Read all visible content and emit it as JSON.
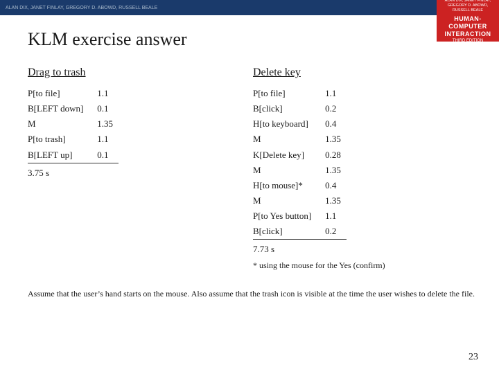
{
  "top_banner": {
    "text": "ALAN DIX, JANET FINLAY, GREGORY D. ABOWD, RUSSELL BEALE"
  },
  "logo": {
    "authors": "ALAN DIX, JANET FINLAY,\nGREGORY D. ABOWD, RUSSELL BEALE",
    "title": "HUMAN-COMPUTER\nINTERACTION",
    "edition": "THIRD EDITION"
  },
  "page_title": "KLM exercise answer",
  "drag_section": {
    "heading": "Drag to trash",
    "steps": [
      {
        "action": "P[to file]",
        "value": "1.1"
      },
      {
        "action": "B[LEFT down]",
        "value": "0.1"
      },
      {
        "action": "M",
        "value": "1.35"
      },
      {
        "action": "P[to trash]",
        "value": "1.1"
      },
      {
        "action": "B[LEFT up]",
        "value": "0.1"
      }
    ],
    "equals": "===",
    "total": "3.75 s"
  },
  "delete_section": {
    "heading": "Delete key",
    "steps": [
      {
        "action": "P[to file]",
        "value": "1.1"
      },
      {
        "action": "B[click]",
        "value": "0.2"
      },
      {
        "action": "H[to keyboard]",
        "value": "0.4"
      },
      {
        "action": "M",
        "value": "1.35"
      },
      {
        "action": "K[Delete key]",
        "value": "0.28"
      },
      {
        "action": "M",
        "value": "1.35"
      },
      {
        "action": "H[to mouse]*",
        "value": "0.4"
      },
      {
        "action": "M",
        "value": "1.35"
      },
      {
        "action": "P[to Yes button]",
        "value": "1.1"
      },
      {
        "action": "B[click]",
        "value": "0.2"
      }
    ],
    "equals": "===",
    "total": "7.73 s",
    "note": "* using the mouse for the Yes (confirm)"
  },
  "bottom_note": "Assume that the user’s hand starts on the mouse. Also assume that the trash icon\nis visible at the time the user wishes to delete the file.",
  "page_number": "23"
}
